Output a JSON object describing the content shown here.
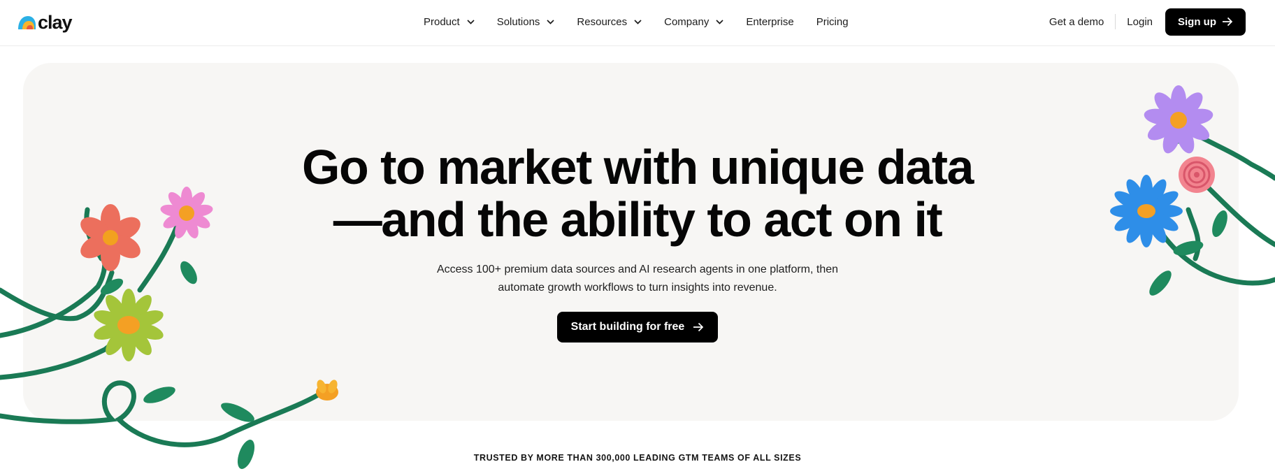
{
  "brand": {
    "name": "clay",
    "logo_colors": [
      "#2bb0e5",
      "#f7b42c",
      "#e8573c"
    ]
  },
  "nav": {
    "items": [
      {
        "label": "Product",
        "has_dropdown": true
      },
      {
        "label": "Solutions",
        "has_dropdown": true
      },
      {
        "label": "Resources",
        "has_dropdown": true
      },
      {
        "label": "Company",
        "has_dropdown": true
      },
      {
        "label": "Enterprise",
        "has_dropdown": false
      },
      {
        "label": "Pricing",
        "has_dropdown": false
      }
    ],
    "demo_label": "Get a demo",
    "login_label": "Login",
    "signup_label": "Sign up"
  },
  "hero": {
    "headline_line1": "Go to market with unique data",
    "headline_line2": "—and the ability to act on it",
    "sub_line1": "Access 100+ premium data sources and AI research agents in one platform, then",
    "sub_line2": "automate growth workflows to turn insights into revenue.",
    "cta_label": "Start building for free",
    "background": "#f7f6f4"
  },
  "trusted": {
    "text": "TRUSTED BY MORE THAN 300,000 LEADING GTM TEAMS OF ALL SIZES"
  },
  "icons": {
    "chevron": "chevron-down-icon",
    "arrow": "arrow-right-icon"
  },
  "colors": {
    "button_bg": "#000000",
    "stem": "#1a7a55",
    "flower_red": "#ec6f5d",
    "flower_pink": "#ee8ad2",
    "flower_lime": "#a4c53a",
    "flower_purple": "#b38cf0",
    "flower_blue": "#2e8ee8",
    "flower_rose": "#f2848f",
    "flower_orange": "#f4a024"
  }
}
